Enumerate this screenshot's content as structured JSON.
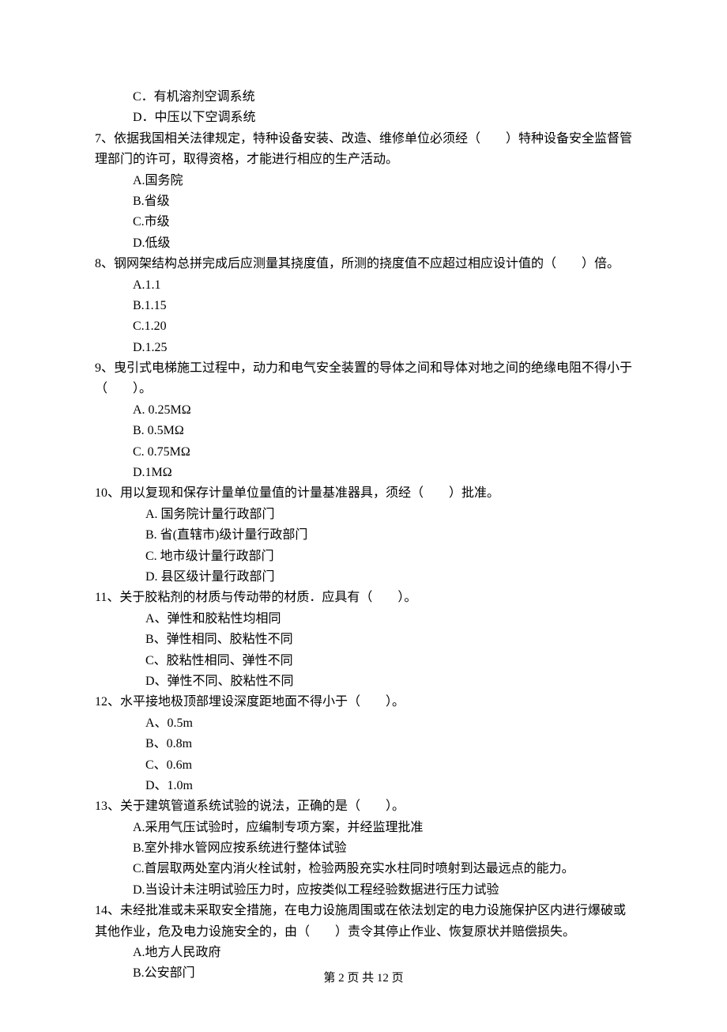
{
  "q6": {
    "optC": "C．有机溶剂空调系统",
    "optD": "D．中压以下空调系统"
  },
  "q7": {
    "text": "7、依据我国相关法律规定，特种设备安装、改造、维修单位必须经（　　）特种设备安全监督管理部门的许可，取得资格，才能进行相应的生产活动。",
    "optA": "A.国务院",
    "optB": "B.省级",
    "optC": "C.市级",
    "optD": "D.低级"
  },
  "q8": {
    "text": "8、钢网架结构总拼完成后应测量其挠度值，所测的挠度值不应超过相应设计值的（　　）倍。",
    "optA": "A.1.1",
    "optB": "B.1.15",
    "optC": "C.1.20",
    "optD": "D.1.25"
  },
  "q9": {
    "text": "9、曳引式电梯施工过程中，动力和电气安全装置的导体之间和导体对地之间的绝缘电阻不得小于（　　）。",
    "optA": "A. 0.25MΩ",
    "optB": "B. 0.5MΩ",
    "optC": "C. 0.75MΩ",
    "optD": "D.1MΩ"
  },
  "q10": {
    "text": "10、用以复现和保存计量单位量值的计量基准器具，须经（　　）批准。",
    "optA": "A. 国务院计量行政部门",
    "optB": "B. 省(直辖市)级计量行政部门",
    "optC": "C. 地市级计量行政部门",
    "optD": "D. 县区级计量行政部门"
  },
  "q11": {
    "text": "11、关于胶粘剂的材质与传动带的材质．应具有（　　）。",
    "optA": "A、弹性和胶粘性均相同",
    "optB": "B、弹性相同、胶粘性不同",
    "optC": "C、胶粘性相同、弹性不同",
    "optD": "D、弹性不同、胶粘性不同"
  },
  "q12": {
    "text": "12、水平接地极顶部埋设深度距地面不得小于（　　）。",
    "optA": "A、0.5m",
    "optB": "B、0.8m",
    "optC": "C、0.6m",
    "optD": "D、1.0m"
  },
  "q13": {
    "text": "13、关于建筑管道系统试验的说法，正确的是（　　）。",
    "optA": "A.采用气压试验时，应编制专项方案，并经监理批准",
    "optB": "B.室外排水管网应按系统进行整体试验",
    "optC": "C.首层取两处室内消火栓试射，检验两股充实水柱同时喷射到达最远点的能力。",
    "optD": "D.当设计未注明试验压力时，应按类似工程经验数据进行压力试验"
  },
  "q14": {
    "text": "14、未经批准或未采取安全措施，在电力设施周围或在依法划定的电力设施保护区内进行爆破或其他作业，危及电力设施安全的，由（　　）责令其停止作业、恢复原状并赔偿损失。",
    "optA": "A.地方人民政府",
    "optB": "B.公安部门"
  },
  "footer": "第 2 页 共 12 页"
}
